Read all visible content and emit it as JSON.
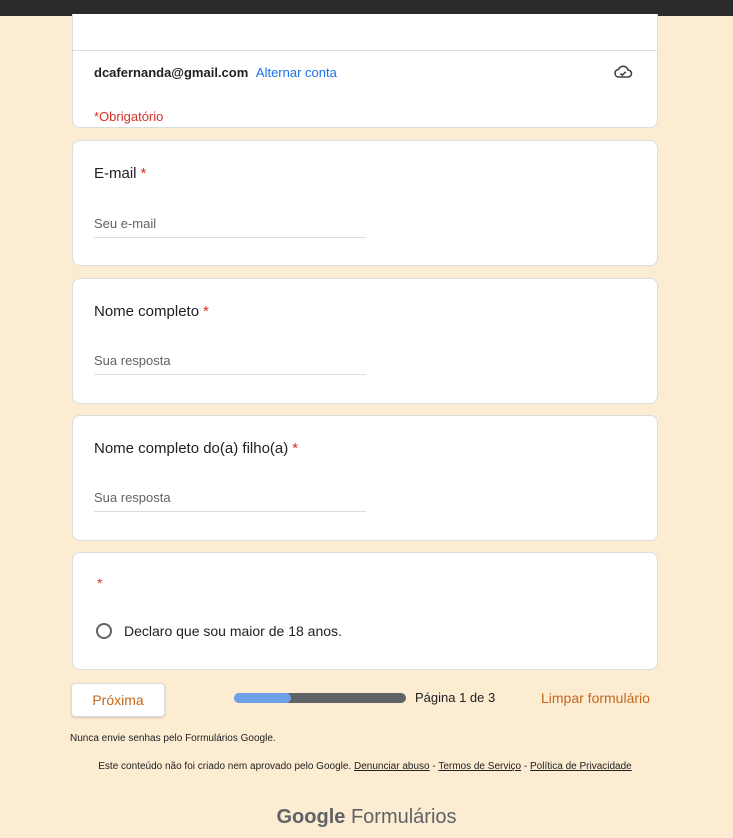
{
  "account": {
    "email": "dcafernanda@gmail.com",
    "switch_label": "Alternar conta",
    "required_note": "*Obrigatório"
  },
  "questions": [
    {
      "title": "E-mail",
      "required_mark": "*",
      "placeholder": "Seu e-mail"
    },
    {
      "title": "Nome completo",
      "required_mark": "*",
      "placeholder": "Sua resposta"
    },
    {
      "title": "Nome completo do(a) filho(a)",
      "required_mark": "*",
      "placeholder": "Sua resposta"
    },
    {
      "title": "",
      "required_mark": "*",
      "option": "Declaro que sou maior de 18 anos."
    }
  ],
  "nav": {
    "next_label": "Próxima",
    "progress": 0.33,
    "page_label": "Página 1 de 3",
    "clear_label": "Limpar formulário"
  },
  "footer": {
    "note": "Nunca envie senhas pelo Formulários Google.",
    "disclaimer": "Este conteúdo não foi criado nem aprovado pelo Google.",
    "report_abuse": "Denunciar abuso",
    "sep1": " - ",
    "terms": "Termos de Serviço",
    "sep2": " - ",
    "privacy": "Política de Privacidade",
    "brand_google": "Google",
    "brand_forms": "Formulários"
  },
  "colors": {
    "background": "#fcecd2",
    "accent": "#c5671d",
    "link": "#1a73e8",
    "required": "#d93025",
    "progress_fill": "#6ea1e8"
  },
  "icons": {
    "cloud": "cloud-saved-icon",
    "radio": "radio-unchecked-icon"
  }
}
